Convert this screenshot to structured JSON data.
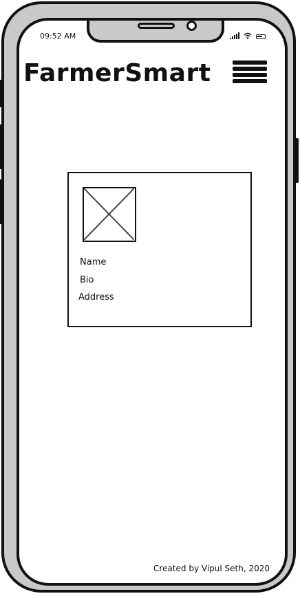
{
  "status_bar": {
    "time": "09:52 AM",
    "icons": [
      "signal-icon",
      "wifi-icon",
      "battery-icon"
    ]
  },
  "header": {
    "title": "FarmerSmart",
    "menu_icon": "hamburger-menu-icon"
  },
  "profile_card": {
    "image_placeholder": "image-placeholder-icon",
    "fields": {
      "name": "Name",
      "bio": "Bio",
      "address": "Address"
    }
  },
  "footer": {
    "credit": "Created by Vipul Seth, 2020"
  }
}
